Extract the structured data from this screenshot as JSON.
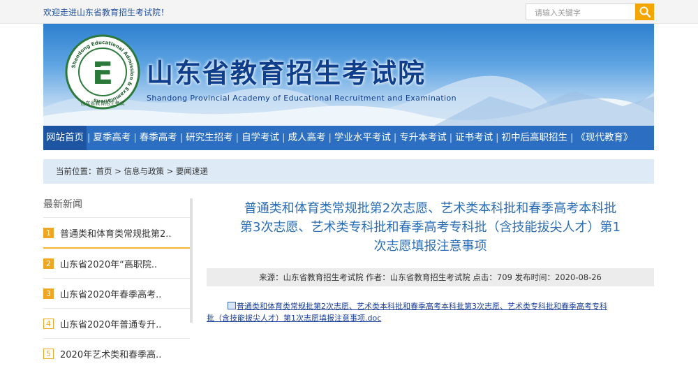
{
  "topbar": {
    "welcome": "欢迎走进山东省教育招生考试院！",
    "search_placeholder": "请输入关键字",
    "search_button_icon": "search-icon"
  },
  "banner": {
    "title": "山东省教育招生考试院",
    "subtitle": "Shandong Provincial Academy of Educational Recruitment and Examination",
    "logo_ring_text": "Shandong Educational Admission & Examinations",
    "logo_inner_text": "山东省教育招生考试",
    "logo_letter": "E"
  },
  "nav": {
    "items": [
      "网站首页",
      "夏季高考",
      "春季高考",
      "研究生招考",
      "自学考试",
      "成人高考",
      "学业水平考试",
      "专升本考试",
      "证书考试",
      "初中后高职招生",
      "《现代教育》"
    ]
  },
  "breadcrumb": {
    "text": "当前位置：首页 > 信息与政策 > 要闻速递"
  },
  "sidebar": {
    "title": "最新新闻",
    "items": [
      {
        "num": "1",
        "text": "普通类和体育类常规批第2.."
      },
      {
        "num": "2",
        "text": "山东省2020年“高职院.."
      },
      {
        "num": "3",
        "text": "山东省2020年春季高考.."
      },
      {
        "num": "4",
        "text": "山东省2020年普通专升.."
      },
      {
        "num": "5",
        "text": "2020年艺术类和春季高.."
      }
    ]
  },
  "article": {
    "title_line1": "普通类和体育类常规批第2次志愿、艺术类本科批和春季高考本科批",
    "title_line2": "第3次志愿、艺术类专科批和春季高考专科批（含技能拔尖人才）第1",
    "title_line3": "次志愿填报注意事项",
    "meta": "来源：山东省教育招生考试院 作者：山东省教育招生考试院 点击：709 发布时间：2020-08-26",
    "attachment_line1": "普通类和体育类常规批第2次志愿、艺术类本科批和春季高考本科批第3次志愿、艺术类专科批和春季高考专科",
    "attachment_line2": "批（含技能拔尖人才）第1次志愿填报注意事项.doc"
  },
  "colors": {
    "nav_bg": "#2c6fc2",
    "nav_active": "#1d55a3",
    "accent_orange": "#f0a623",
    "title_blue": "#2a6db6"
  }
}
